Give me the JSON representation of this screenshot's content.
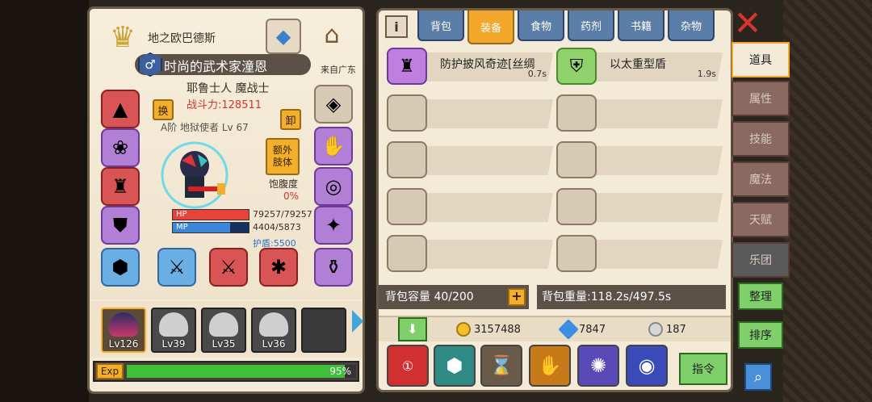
{
  "character": {
    "realm_name": "地之欧巴德斯",
    "title": "时尚的武术家潼恩",
    "from": "来自广东",
    "race_class": "耶鲁士人 魔战士",
    "power": "战斗力:128511",
    "swap_label": "换",
    "unequip_label": "卸",
    "extra_limb_line1": "额外",
    "extra_limb_line2": "肢体",
    "a_rank": "A阶 地狱使者 Lv 67",
    "hunger_label": "饱腹度",
    "hunger_value": "0%",
    "hp_label": "HP",
    "hp_value": "79257/79257",
    "hp_fraction": 1.0,
    "mp_label": "MP",
    "mp_value": "4404/5873",
    "mp_fraction": 0.75,
    "shield": "护盾:5500"
  },
  "party": [
    {
      "level": "Lv126"
    },
    {
      "level": "Lv39"
    },
    {
      "level": "Lv35"
    },
    {
      "level": "Lv36"
    }
  ],
  "exp": {
    "label": "Exp",
    "percent": "95%",
    "fraction": 0.95
  },
  "inventory": {
    "tabs": [
      "背包",
      "装备",
      "食物",
      "药剂",
      "书籍",
      "杂物"
    ],
    "active_tab": "装备",
    "items": [
      {
        "name": "防护披风奇迹[丝绸",
        "time": "0.7s",
        "icon": "cloak-icon"
      },
      {
        "name": "以太重型盾",
        "time": "1.9s",
        "icon": "shield-icon"
      }
    ],
    "capacity": "背包容量 40/200",
    "weight": "背包重量:118.2s/497.5s",
    "gold": "3157488",
    "gems": "7847",
    "coins": "187",
    "command_label": "指令"
  },
  "side_tabs": [
    "道具",
    "属性",
    "技能",
    "魔法",
    "天赋",
    "乐团"
  ],
  "side_buttons": {
    "sort": "整理",
    "order": "排序"
  }
}
